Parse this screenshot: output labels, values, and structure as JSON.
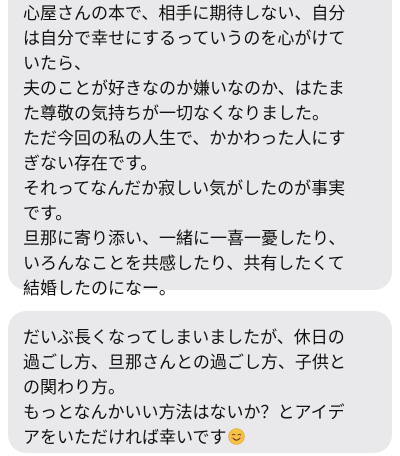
{
  "messages": [
    {
      "lines": [
        "心屋さんの本で、相手に期待しない、自分",
        "は自分で幸せにするっていうのを心がけて",
        "いたら、",
        "夫のことが好きなのか嫌いなのか、はたま",
        "た尊敬の気持ちが一切なくなりました。",
        "ただ今回の私の人生で、かかわった人にす",
        "ぎない存在です。",
        "それってなんだか寂しい気がしたのが事実",
        "です。",
        "旦那に寄り添い、一緒に一喜一憂したり、",
        "いろんなことを共感したり、共有したくて",
        "結婚したのになー。"
      ]
    },
    {
      "lines": [
        "だいぶ長くなってしまいましたが、休日の",
        "過ごし方、旦那さんとの過ごし方、子供と",
        "の関わり方。",
        "もっとなんかいい方法はないか？とアイデ",
        "アをいただければ幸いです"
      ],
      "trailing_emoji": "smiling-face-emoji"
    }
  ],
  "colors": {
    "bubble_background": "#e9e9eb",
    "text": "#111111",
    "page_background": "#ffffff"
  }
}
